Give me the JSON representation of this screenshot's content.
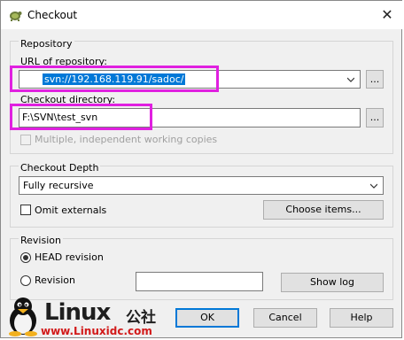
{
  "window": {
    "title": "Checkout",
    "close_glyph": "✕",
    "icons": [
      "tortoisesvn-app-icon",
      "close-icon"
    ]
  },
  "repository": {
    "group_label": "Repository",
    "url_label": "URL of repository:",
    "url_value": "svn://192.168.119.91/sadoc/",
    "browse_label": "...",
    "checkout_dir_label": "Checkout directory:",
    "checkout_dir_value": "F:\\SVN\\test_svn",
    "browse_dir_label": "...",
    "multiple_wc_label": "Multiple, independent working copies",
    "multiple_wc_checked": false
  },
  "depth": {
    "group_label": "Checkout Depth",
    "selected": "Fully recursive",
    "omit_externals_label": "Omit externals",
    "omit_externals_checked": false,
    "choose_items_label": "Choose items..."
  },
  "revision": {
    "group_label": "Revision",
    "head_label": "HEAD revision",
    "head_selected": true,
    "revision_label": "Revision",
    "revision_value": "",
    "show_log_label": "Show log"
  },
  "buttons": {
    "ok": "OK",
    "cancel": "Cancel",
    "help": "Help"
  },
  "watermark": {
    "brand_prefix": "Linux",
    "brand_suffix": "公社",
    "url": "www.Linuxidc.com"
  },
  "colors": {
    "highlight_box": "#e020e0",
    "selection": "#0078d7",
    "default_button_border": "#0078d7",
    "watermark_url": "#d21a1a"
  }
}
